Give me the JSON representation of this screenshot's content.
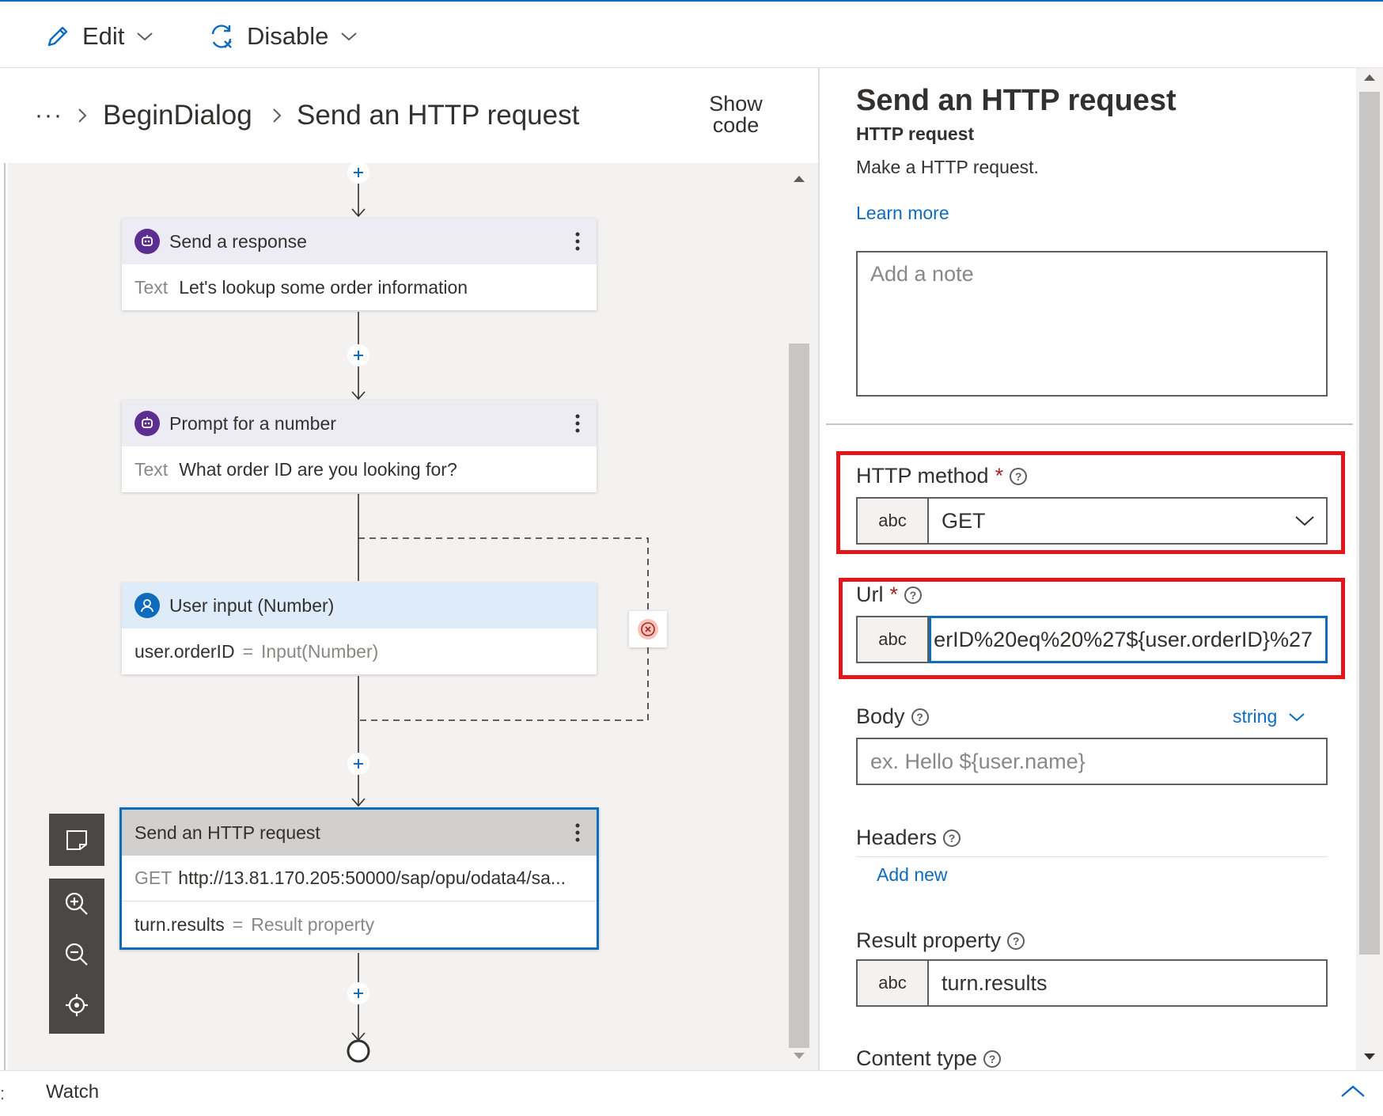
{
  "toolbar": {
    "edit_label": "Edit",
    "disable_label": "Disable"
  },
  "breadcrumb": {
    "ellipsis": "···",
    "items": [
      "BeginDialog",
      "Send an HTTP request"
    ],
    "show_code": [
      "Show",
      "code"
    ]
  },
  "nodes": {
    "send_response": {
      "title": "Send a response",
      "row_label": "Text",
      "row_value": "Let's lookup some order information"
    },
    "prompt_number": {
      "title": "Prompt for a number",
      "row_label": "Text",
      "row_value": "What order ID are you looking for?"
    },
    "user_input": {
      "title": "User input (Number)",
      "property": "user.orderID",
      "equals": "=",
      "value": "Input(Number)"
    },
    "http_request": {
      "title": "Send an HTTP request",
      "method": "GET",
      "url": "http://13.81.170.205:50000/sap/opu/odata4/sa...",
      "result_property": "turn.results",
      "equals": "=",
      "result_label": "Result property"
    }
  },
  "panel": {
    "title": "Send an HTTP request",
    "subtitle": "HTTP request",
    "description": "Make a HTTP request.",
    "learn_more": "Learn more",
    "note_placeholder": "Add a note",
    "http_method": {
      "label": "HTTP method",
      "required": "*",
      "type_tag": "abc",
      "value": "GET"
    },
    "url": {
      "label": "Url",
      "required": "*",
      "type_tag": "abc",
      "value": "erID%20eq%20%27${user.orderID}%27"
    },
    "body": {
      "label": "Body",
      "type_select": "string",
      "placeholder": "ex. Hello ${user.name}"
    },
    "headers": {
      "label": "Headers",
      "add_new": "Add new"
    },
    "result_property": {
      "label": "Result property",
      "type_tag": "abc",
      "value": "turn.results"
    },
    "content_type": {
      "label": "Content type"
    }
  },
  "footer": {
    "watch_label": "Watch"
  },
  "colors": {
    "accent": "#0f6cbd",
    "highlight": "#e3161b",
    "bot_badge": "#5c2e91",
    "user_badge": "#0f6cbd",
    "selected_border": "#0f6cbd"
  },
  "icons": [
    "pencil-icon",
    "disable-icon",
    "chevron-down-icon",
    "chevron-right-icon",
    "bot-icon",
    "user-icon",
    "more-icon",
    "plus-icon",
    "dismiss-icon",
    "note-icon",
    "zoom-in-icon",
    "zoom-out-icon",
    "center-icon",
    "question-icon",
    "chevron-up-icon"
  ]
}
